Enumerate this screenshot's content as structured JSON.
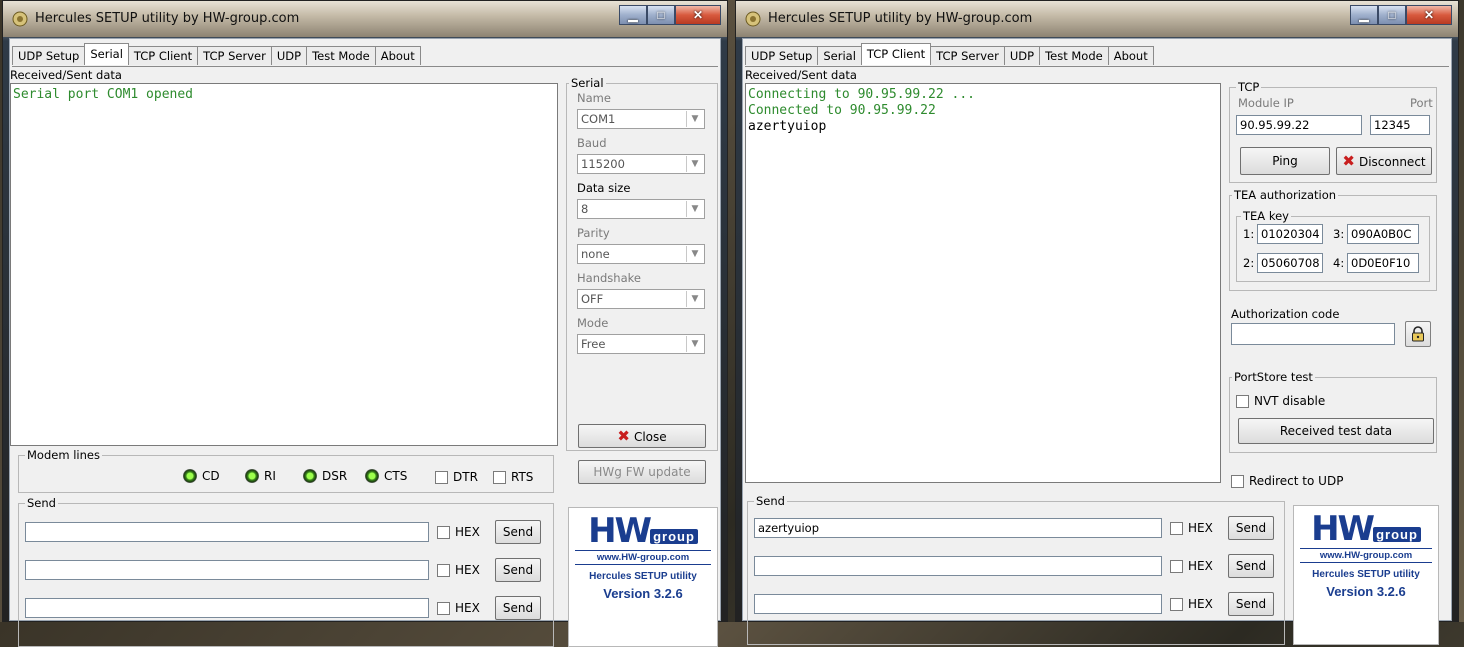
{
  "left_window": {
    "title": "Hercules SETUP utility by HW-group.com",
    "tabs": [
      {
        "label": "UDP Setup",
        "active": false
      },
      {
        "label": "Serial",
        "active": true
      },
      {
        "label": "TCP Client",
        "active": false
      },
      {
        "label": "TCP Server",
        "active": false
      },
      {
        "label": "UDP",
        "active": false
      },
      {
        "label": "Test Mode",
        "active": false
      },
      {
        "label": "About",
        "active": false
      }
    ],
    "received_label": "Received/Sent data",
    "received_lines": [
      "Serial port COM1 opened"
    ],
    "serial": {
      "group_label": "Serial",
      "name_label": "Name",
      "name_value": "COM1",
      "baud_label": "Baud",
      "baud_value": "115200",
      "datasize_label": "Data size",
      "datasize_value": "8",
      "parity_label": "Parity",
      "parity_value": "none",
      "handshake_label": "Handshake",
      "handshake_value": "OFF",
      "mode_label": "Mode",
      "mode_value": "Free"
    },
    "close_button": "Close",
    "hwg_update_button": "HWg FW update",
    "modem": {
      "group_label": "Modem lines",
      "leds": [
        "CD",
        "RI",
        "DSR",
        "CTS"
      ],
      "dtr": "DTR",
      "rts": "RTS"
    },
    "send": {
      "group_label": "Send",
      "rows": [
        {
          "value": "",
          "hex": "HEX",
          "button": "Send"
        },
        {
          "value": "",
          "hex": "HEX",
          "button": "Send"
        },
        {
          "value": "",
          "hex": "HEX",
          "button": "Send"
        }
      ]
    },
    "logo": {
      "hw": "HW",
      "group": "group",
      "url": "www.HW-group.com",
      "app": "Hercules SETUP utility",
      "version": "Version  3.2.6"
    }
  },
  "right_window": {
    "title": "Hercules SETUP utility by HW-group.com",
    "tabs": [
      {
        "label": "UDP Setup",
        "active": false
      },
      {
        "label": "Serial",
        "active": false
      },
      {
        "label": "TCP Client",
        "active": true
      },
      {
        "label": "TCP Server",
        "active": false
      },
      {
        "label": "UDP",
        "active": false
      },
      {
        "label": "Test Mode",
        "active": false
      },
      {
        "label": "About",
        "active": false
      }
    ],
    "received_label": "Received/Sent data",
    "received_lines": [
      "Connecting to 90.95.99.22 ...",
      "Connected to 90.95.99.22",
      "azertyuiop"
    ],
    "tcp": {
      "group_label": "TCP",
      "module_ip_label": "Module IP",
      "module_ip": "90.95.99.22",
      "port_label": "Port",
      "port": "12345",
      "ping_button": "Ping",
      "disconnect_button": "Disconnect"
    },
    "tea": {
      "group_label": "TEA authorization",
      "key_label": "TEA key",
      "k1_label": "1:",
      "k1": "01020304",
      "k2_label": "2:",
      "k2": "05060708",
      "k3_label": "3:",
      "k3": "090A0B0C",
      "k4_label": "4:",
      "k4": "0D0E0F10"
    },
    "auth_code_label": "Authorization code",
    "auth_code_value": "",
    "portstore": {
      "group_label": "PortStore test",
      "nvt_disable": "NVT disable",
      "received_test_button": "Received test data"
    },
    "redirect_udp": "Redirect to UDP",
    "send": {
      "group_label": "Send",
      "rows": [
        {
          "value": "azertyuiop",
          "hex": "HEX",
          "button": "Send"
        },
        {
          "value": "",
          "hex": "HEX",
          "button": "Send"
        },
        {
          "value": "",
          "hex": "HEX",
          "button": "Send"
        }
      ]
    },
    "logo": {
      "hw": "HW",
      "group": "group",
      "url": "www.HW-group.com",
      "app": "Hercules SETUP utility",
      "version": "Version  3.2.6"
    }
  }
}
